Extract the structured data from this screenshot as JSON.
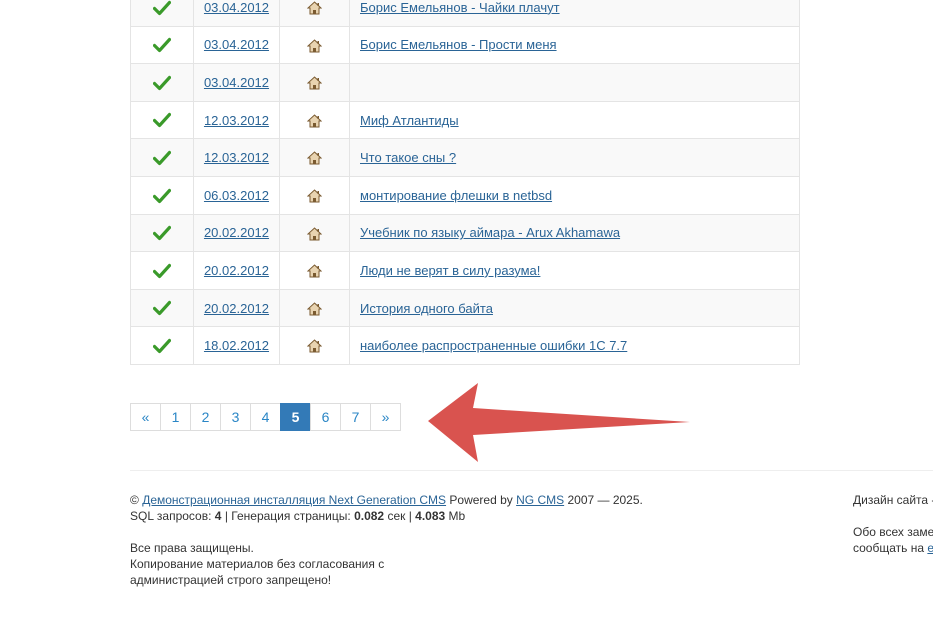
{
  "news_rows": [
    {
      "date": "03.04.2012",
      "title": "Борис Емельянов - Чайки плачут"
    },
    {
      "date": "03.04.2012",
      "title": "Борис Емельянов - Прости меня"
    },
    {
      "date": "03.04.2012",
      "title": ""
    },
    {
      "date": "12.03.2012",
      "title": "Миф Атлантиды"
    },
    {
      "date": "12.03.2012",
      "title": "Что такое сны ?"
    },
    {
      "date": "06.03.2012",
      "title": "монтирование флешки в netbsd"
    },
    {
      "date": "20.02.2012",
      "title": "Учебник по языку аймара - Arux Akhamawa"
    },
    {
      "date": "20.02.2012",
      "title": "Люди не верят в силу разума!"
    },
    {
      "date": "20.02.2012",
      "title": "История одного байта"
    },
    {
      "date": "18.02.2012",
      "title": "наиболее распространенные ошибки 1С 7.7"
    }
  ],
  "icons": {
    "status": "check-icon",
    "category": "house-icon",
    "annotation": "arrow-left-icon"
  },
  "colors": {
    "check": "#3a9a2a",
    "arrow": "#d9534f",
    "pagination_active": "#337ab7"
  },
  "pagination": {
    "prev": "«",
    "pages": [
      "1",
      "2",
      "3",
      "4",
      "5",
      "6",
      "7"
    ],
    "active": "5",
    "next": "»"
  },
  "footer": {
    "copyright_symbol": "©",
    "site_link": "Демонстрационная инсталляция Next Generation CMS",
    "powered_by": "Powered by",
    "cms_link": "NG CMS",
    "years": "2007 — 2025.",
    "sql_label": "SQL запросов:",
    "sql_count": "4",
    "gen_label": "| Генерация страницы:",
    "gen_time": "0.082",
    "gen_unit": "сек |",
    "mem": "4.083",
    "mem_unit": "Mb",
    "rights": "Все права защищены.",
    "copy_line1": "Копирование материалов без согласования с",
    "copy_line2": "администрацией строго запрещено!",
    "design": "Дизайн сайта -",
    "errors_line1": "Обо всех заме",
    "errors_line2": "сообщать на",
    "errors_link": "e"
  }
}
